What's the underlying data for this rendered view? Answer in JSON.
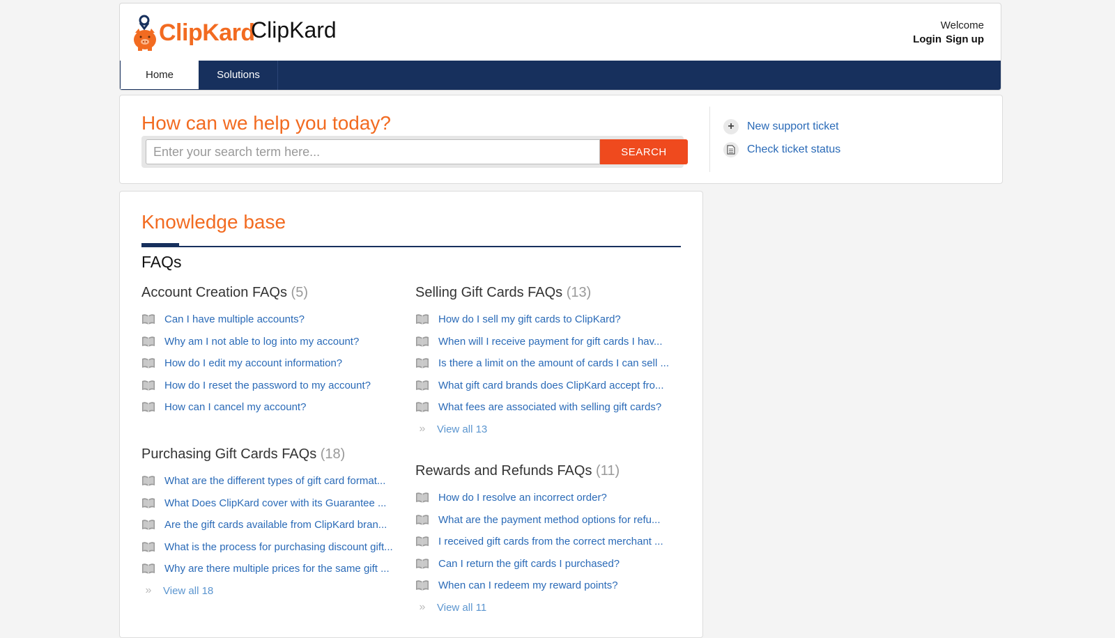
{
  "brand": {
    "logo_text_clip": "Clip",
    "logo_text_kard": "Kard",
    "site_name": "ClipKard"
  },
  "user": {
    "welcome": "Welcome",
    "login": "Login",
    "signup": "Sign up"
  },
  "nav": {
    "tabs": [
      {
        "label": "Home"
      },
      {
        "label": "Solutions"
      }
    ]
  },
  "search": {
    "title": "How can we help you today?",
    "placeholder": "Enter your search term here...",
    "button": "SEARCH"
  },
  "side_links": [
    {
      "label": "New support ticket",
      "icon": "plus-icon"
    },
    {
      "label": "Check ticket status",
      "icon": "document-icon"
    }
  ],
  "kb": {
    "title": "Knowledge base",
    "faqs_heading": "FAQs",
    "categories": [
      {
        "title": "Account Creation FAQs",
        "count": "(5)",
        "articles": [
          "Can I have multiple accounts?",
          "Why am I not able to log into my account?",
          "How do I edit my account information?",
          "How do I reset the password to my account?",
          "How can I cancel my account?"
        ],
        "view_all": ""
      },
      {
        "title": "Selling Gift Cards FAQs",
        "count": "(13)",
        "articles": [
          "How do I sell my gift cards to ClipKard?",
          "When will I receive payment for gift cards I hav...",
          "Is there a limit on the amount of cards I can sell ...",
          "What gift card brands does ClipKard accept fro...",
          "What fees are associated with selling gift cards?"
        ],
        "view_all": "View all 13"
      },
      {
        "title": "Purchasing Gift Cards FAQs",
        "count": "(18)",
        "articles": [
          "What are the different types of gift card format...",
          "What Does ClipKard cover with its Guarantee ...",
          "Are the gift cards available from ClipKard bran...",
          "What is the process for purchasing discount gift...",
          "Why are there multiple prices for the same gift ..."
        ],
        "view_all": "View all 18"
      },
      {
        "title": "Rewards and Refunds FAQs",
        "count": "(11)",
        "articles": [
          "How do I resolve an incorrect order?",
          "What are the payment method options for refu...",
          "I received gift cards from the correct merchant ...",
          "Can I return the gift cards I purchased?",
          "When can I redeem my reward points?"
        ],
        "view_all": "View all 11"
      }
    ]
  },
  "colors": {
    "accent": "#f26b21",
    "nav": "#17305d",
    "link": "#2a6ab7",
    "search_button": "#ef4a1e"
  }
}
